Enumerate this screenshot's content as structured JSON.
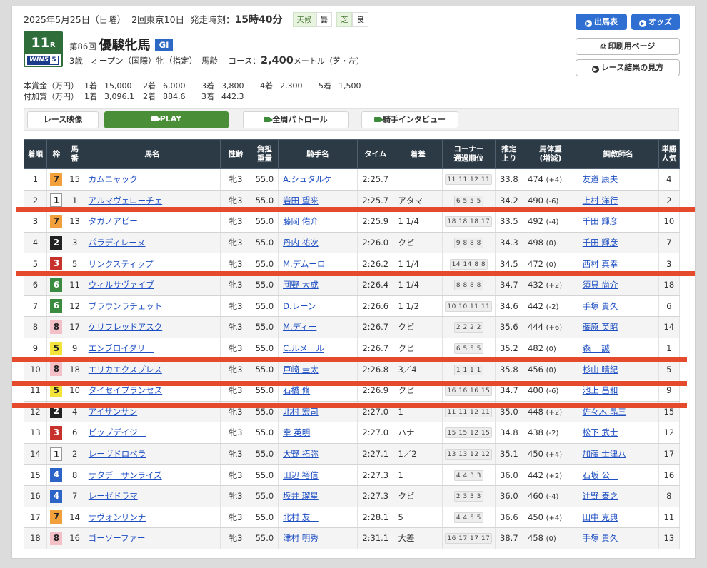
{
  "header": {
    "date": "2025年5月25日（日曜）",
    "meeting": "2回東京10日",
    "post_time_label": "発走時刻：",
    "post_time": "15時40分",
    "weather_label": "天候",
    "weather": "曇",
    "track_label": "芝",
    "track_condition": "良",
    "race_number": "11",
    "race_unit": "R",
    "win5_label": "WIN5",
    "win5_num": "5",
    "kai": "第86回",
    "race_name": "優駿牝馬",
    "grade": "GI",
    "conditions": "3歳　オープン（国際）牝（指定）　馬齢",
    "course_label": "コース：",
    "distance": "2,400",
    "distance_unit": "メートル（芝・左）"
  },
  "buttons": {
    "entries": "出馬表",
    "odds": "オッズ",
    "print": "印刷用ページ",
    "howto": "レース結果の見方"
  },
  "prizes": {
    "main_label": "本賞金（万円）",
    "main": [
      [
        "1着",
        "15,000"
      ],
      [
        "2着",
        "6,000"
      ],
      [
        "3着",
        "3,800"
      ],
      [
        "4着",
        "2,300"
      ],
      [
        "5着",
        "1,500"
      ]
    ],
    "added_label": "付加賞（万円）",
    "added": [
      [
        "1着",
        "3,096.1"
      ],
      [
        "2着",
        "884.6"
      ],
      [
        "3着",
        "442.3"
      ]
    ]
  },
  "video": {
    "label": "レース映像",
    "play": "PLAY",
    "patrol": "全周パトロール",
    "interview": "騎手インタビュー"
  },
  "table": {
    "headers": {
      "rank": "着順",
      "frame": "枠",
      "num1": "馬",
      "num2": "番",
      "horse": "馬名",
      "sexage": "性齢",
      "weight1": "負担",
      "weight2": "重量",
      "jockey": "騎手名",
      "time": "タイム",
      "margin": "着差",
      "corner1": "コーナー",
      "corner2": "通過順位",
      "last1": "推定",
      "last2": "上り",
      "body1": "馬体重",
      "body2": "(増減)",
      "trainer": "調教師名",
      "pop1": "単勝",
      "pop2": "人気"
    },
    "frame_colors": {
      "1": {
        "bg": "#ffffff",
        "fg": "#222222"
      },
      "2": {
        "bg": "#222222",
        "fg": "#ffffff"
      },
      "3": {
        "bg": "#c8322d",
        "fg": "#ffffff"
      },
      "4": {
        "bg": "#2d64c8",
        "fg": "#ffffff"
      },
      "5": {
        "bg": "#f3e23a",
        "fg": "#222222"
      },
      "6": {
        "bg": "#3a8a3f",
        "fg": "#ffffff"
      },
      "7": {
        "bg": "#f2a03c",
        "fg": "#222222"
      },
      "8": {
        "bg": "#f4c0c8",
        "fg": "#222222"
      }
    },
    "rows": [
      {
        "rank": "1",
        "frame": "7",
        "num": "15",
        "horse": "カムニャック",
        "sexage": "牝3",
        "weight": "55.0",
        "jockey": "A.シュタルケ",
        "time": "2:25.7",
        "margin": "",
        "corner": "11 11 12 11",
        "last3f": "33.8",
        "body": "474",
        "diff": "(+4)",
        "trainer": "友道 康夫",
        "pop": "4"
      },
      {
        "rank": "2",
        "frame": "1",
        "num": "1",
        "horse": "アルマヴェローチェ",
        "sexage": "牝3",
        "weight": "55.0",
        "jockey": "岩田 望来",
        "time": "2:25.7",
        "margin": "アタマ",
        "corner": "6 5 5 5",
        "last3f": "34.2",
        "body": "490",
        "diff": "(-6)",
        "trainer": "上村 洋行",
        "pop": "2"
      },
      {
        "rank": "3",
        "frame": "7",
        "num": "13",
        "horse": "タガノアビー",
        "sexage": "牝3",
        "weight": "55.0",
        "jockey": "藤岡 佑介",
        "time": "2:25.9",
        "margin": "1 1/4",
        "corner": "18 18 18 17",
        "last3f": "33.5",
        "body": "492",
        "diff": "(-4)",
        "trainer": "千田 輝彦",
        "pop": "10"
      },
      {
        "rank": "4",
        "frame": "2",
        "num": "3",
        "horse": "パラディレーヌ",
        "sexage": "牝3",
        "weight": "55.0",
        "jockey": "丹内 祐次",
        "time": "2:26.0",
        "margin": "クビ",
        "corner": "9 8 8 8",
        "last3f": "34.3",
        "body": "498",
        "diff": "(0)",
        "trainer": "千田 輝彦",
        "pop": "7"
      },
      {
        "rank": "5",
        "frame": "3",
        "num": "5",
        "horse": "リンクスティップ",
        "sexage": "牝3",
        "weight": "55.0",
        "jockey": "M.デムーロ",
        "time": "2:26.2",
        "margin": "1 1/4",
        "corner": "14 14 8 8",
        "last3f": "34.5",
        "body": "472",
        "diff": "(0)",
        "trainer": "西村 真幸",
        "pop": "3"
      },
      {
        "rank": "6",
        "frame": "6",
        "num": "11",
        "horse": "ウィルサヴァイブ",
        "sexage": "牝3",
        "weight": "55.0",
        "jockey": "団野 大成",
        "time": "2:26.4",
        "margin": "1 1/4",
        "corner": "8 8 8 8",
        "last3f": "34.7",
        "body": "432",
        "diff": "(+2)",
        "trainer": "須貝 尚介",
        "pop": "18"
      },
      {
        "rank": "7",
        "frame": "6",
        "num": "12",
        "horse": "ブラウンラチェット",
        "sexage": "牝3",
        "weight": "55.0",
        "jockey": "D.レーン",
        "time": "2:26.6",
        "margin": "1 1/2",
        "corner": "10 10 11 11",
        "last3f": "34.6",
        "body": "442",
        "diff": "(-2)",
        "trainer": "手塚 貴久",
        "pop": "6"
      },
      {
        "rank": "8",
        "frame": "8",
        "num": "17",
        "horse": "ケリフレッドアスク",
        "sexage": "牝3",
        "weight": "55.0",
        "jockey": "M.ディー",
        "time": "2:26.7",
        "margin": "クビ",
        "corner": "2 2 2 2",
        "last3f": "35.6",
        "body": "444",
        "diff": "(+6)",
        "trainer": "藤原 英昭",
        "pop": "14"
      },
      {
        "rank": "9",
        "frame": "5",
        "num": "9",
        "horse": "エンブロイダリー",
        "sexage": "牝3",
        "weight": "55.0",
        "jockey": "C.ルメール",
        "time": "2:26.7",
        "margin": "クビ",
        "corner": "6 5 5 5",
        "last3f": "35.2",
        "body": "482",
        "diff": "(0)",
        "trainer": "森 一誠",
        "pop": "1"
      },
      {
        "rank": "10",
        "frame": "8",
        "num": "18",
        "horse": "エリカエクスプレス",
        "sexage": "牝3",
        "weight": "55.0",
        "jockey": "戸崎 圭太",
        "time": "2:26.8",
        "margin": "3／4",
        "corner": "1 1 1 1",
        "last3f": "35.8",
        "body": "456",
        "diff": "(0)",
        "trainer": "杉山 晴紀",
        "pop": "5"
      },
      {
        "rank": "11",
        "frame": "5",
        "num": "10",
        "horse": "タイセイプランセス",
        "sexage": "牝3",
        "weight": "55.0",
        "jockey": "石橋 脩",
        "time": "2:26.9",
        "margin": "クビ",
        "corner": "16 16 16 15",
        "last3f": "34.7",
        "body": "400",
        "diff": "(-6)",
        "trainer": "池上 昌和",
        "pop": "9"
      },
      {
        "rank": "12",
        "frame": "2",
        "num": "4",
        "horse": "アイサンサン",
        "sexage": "牝3",
        "weight": "55.0",
        "jockey": "北村 宏司",
        "time": "2:27.0",
        "margin": "1",
        "corner": "11 11 12 11",
        "last3f": "35.0",
        "body": "448",
        "diff": "(+2)",
        "trainer": "佐々木 晶三",
        "pop": "15"
      },
      {
        "rank": "13",
        "frame": "3",
        "num": "6",
        "horse": "ビップデイジー",
        "sexage": "牝3",
        "weight": "55.0",
        "jockey": "幸 英明",
        "time": "2:27.0",
        "margin": "ハナ",
        "corner": "15 15 12 15",
        "last3f": "34.8",
        "body": "438",
        "diff": "(-2)",
        "trainer": "松下 武士",
        "pop": "12"
      },
      {
        "rank": "14",
        "frame": "1",
        "num": "2",
        "horse": "レーヴドロペラ",
        "sexage": "牝3",
        "weight": "55.0",
        "jockey": "大野 拓弥",
        "time": "2:27.1",
        "margin": "1／2",
        "corner": "13 13 12 12",
        "last3f": "35.1",
        "body": "450",
        "diff": "(+4)",
        "trainer": "加藤 士津八",
        "pop": "17"
      },
      {
        "rank": "15",
        "frame": "4",
        "num": "8",
        "horse": "サタデーサンライズ",
        "sexage": "牝3",
        "weight": "55.0",
        "jockey": "田辺 裕信",
        "time": "2:27.3",
        "margin": "1",
        "corner": "4 4 3 3",
        "last3f": "36.0",
        "body": "442",
        "diff": "(+2)",
        "trainer": "石坂 公一",
        "pop": "16"
      },
      {
        "rank": "16",
        "frame": "4",
        "num": "7",
        "horse": "レーゼドラマ",
        "sexage": "牝3",
        "weight": "55.0",
        "jockey": "坂井 瑠星",
        "time": "2:27.3",
        "margin": "クビ",
        "corner": "2 3 3 3",
        "last3f": "36.0",
        "body": "460",
        "diff": "(-4)",
        "trainer": "辻野 泰之",
        "pop": "8"
      },
      {
        "rank": "17",
        "frame": "7",
        "num": "14",
        "horse": "サヴォンリンナ",
        "sexage": "牝3",
        "weight": "55.0",
        "jockey": "北村 友一",
        "time": "2:28.1",
        "margin": "5",
        "corner": "4 4 5 5",
        "last3f": "36.6",
        "body": "450",
        "diff": "(+4)",
        "trainer": "田中 克典",
        "pop": "11"
      },
      {
        "rank": "18",
        "frame": "8",
        "num": "16",
        "horse": "ゴーソーファー",
        "sexage": "牝3",
        "weight": "55.0",
        "jockey": "津村 明秀",
        "time": "2:31.1",
        "margin": "大差",
        "corner": "16 17 17 17",
        "last3f": "38.7",
        "body": "458",
        "diff": "(0)",
        "trainer": "手塚 貴久",
        "pop": "13"
      }
    ]
  },
  "annotation_color": "#e54a2c"
}
